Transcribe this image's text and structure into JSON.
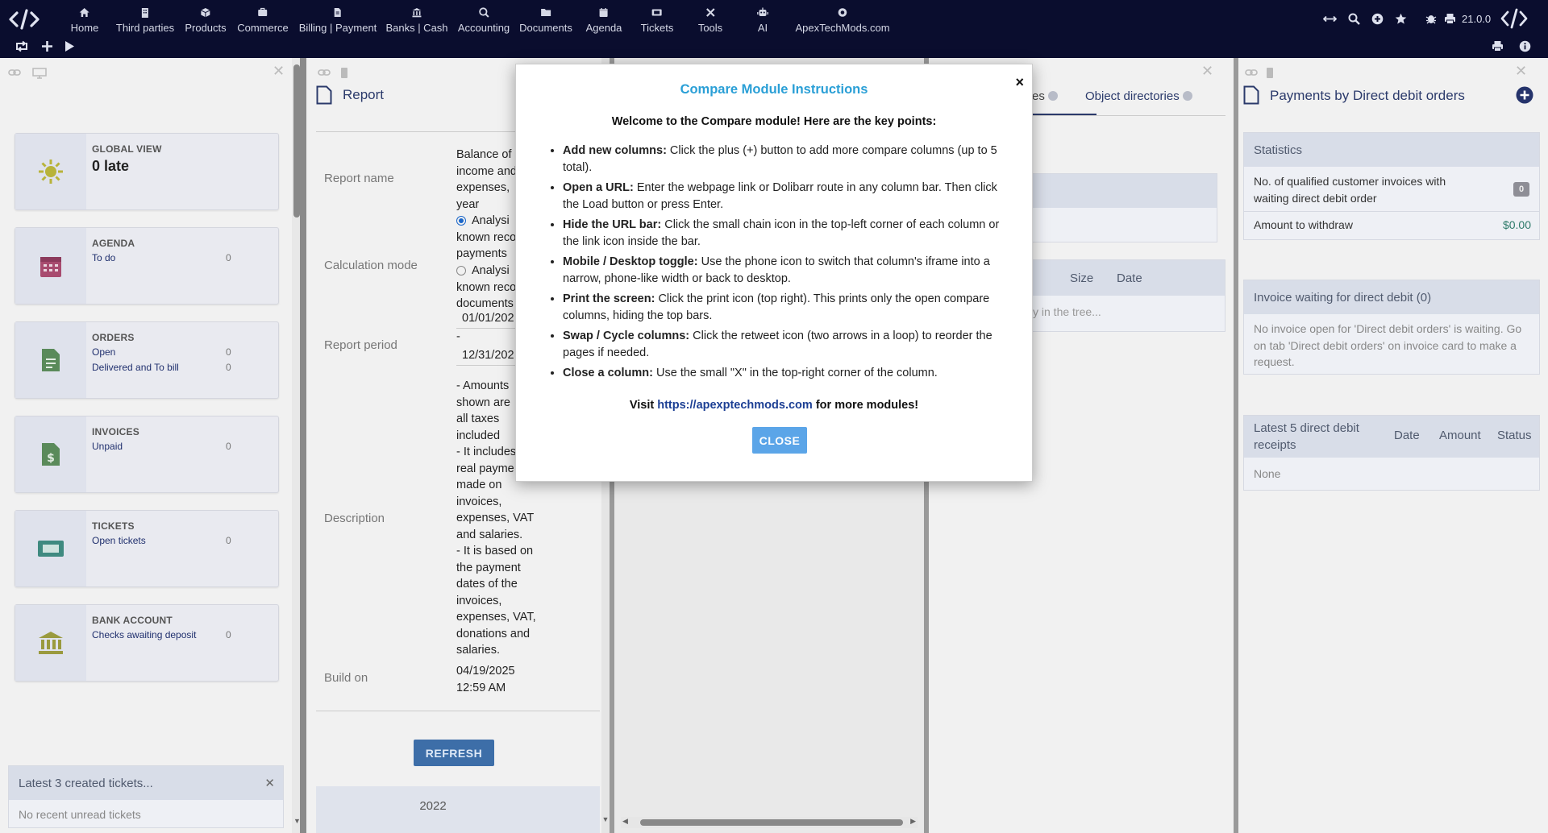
{
  "topbar": {
    "menu": [
      {
        "label": "Home",
        "icon": "home-icon"
      },
      {
        "label": "Third parties",
        "icon": "building-icon"
      },
      {
        "label": "Products",
        "icon": "cube-icon"
      },
      {
        "label": "Commerce",
        "icon": "briefcase-icon"
      },
      {
        "label": "Billing | Payment",
        "icon": "file-invoice-icon"
      },
      {
        "label": "Banks | Cash",
        "icon": "bank-icon"
      },
      {
        "label": "Accounting",
        "icon": "search-dollar-icon"
      },
      {
        "label": "Documents",
        "icon": "folder-icon"
      },
      {
        "label": "Agenda",
        "icon": "calendar-icon"
      },
      {
        "label": "Tickets",
        "icon": "ticket-icon"
      },
      {
        "label": "Tools",
        "icon": "tools-icon"
      },
      {
        "label": "AI",
        "icon": "robot-icon"
      },
      {
        "label": "ApexTechMods.com",
        "icon": "globe-icon"
      }
    ],
    "version": "21.0.0"
  },
  "left_panel": {
    "widgets": [
      {
        "title": "GLOBAL VIEW",
        "big": "0 late",
        "icon": "sun-icon"
      },
      {
        "title": "AGENDA",
        "lines": [
          {
            "label": "To do",
            "count": "0"
          }
        ],
        "icon": "calendar-icon"
      },
      {
        "title": "ORDERS",
        "lines": [
          {
            "label": "Open",
            "count": "0"
          },
          {
            "label": "Delivered and To bill",
            "count": "0"
          }
        ],
        "icon": "order-file-icon"
      },
      {
        "title": "INVOICES",
        "lines": [
          {
            "label": "Unpaid",
            "count": "0"
          }
        ],
        "icon": "invoice-dollar-icon"
      },
      {
        "title": "TICKETS",
        "lines": [
          {
            "label": "Open tickets",
            "count": "0"
          }
        ],
        "icon": "ticket-icon"
      },
      {
        "title": "BANK ACCOUNT",
        "lines": [
          {
            "label": "Checks awaiting deposit",
            "count": "0"
          }
        ],
        "icon": "bank-icon"
      }
    ],
    "tickets_box": {
      "title": "Latest 3 created tickets...",
      "empty": "No recent unread tickets"
    }
  },
  "report_panel": {
    "title": "Report",
    "labels": {
      "report_name": "Report name",
      "calculation_mode": "Calculation mode",
      "report_period": "Report period",
      "description": "Description",
      "build_on": "Build on"
    },
    "report_name_lines": [
      "Balance of",
      "income and",
      "expenses,",
      "year"
    ],
    "calc_option_1": [
      "Analysi",
      "known reco",
      "payments"
    ],
    "calc_option_2": [
      "Analysi",
      "known reco",
      "documents"
    ],
    "period_from": "01/01/202",
    "period_dash": "-",
    "period_to": "12/31/202",
    "description_lines": [
      "- Amounts",
      "shown are",
      "all taxes",
      "included",
      "- It includes",
      "real payme",
      "made on",
      "invoices,",
      "expenses, VAT",
      "and salaries.",
      "- It is based on",
      "the payment",
      "dates of the",
      "invoices,",
      "expenses, VAT,",
      "donations and",
      "salaries."
    ],
    "build_on_lines": [
      "04/19/2025",
      "12:59 AM"
    ],
    "refresh_label": "REFRESH",
    "year_header": "2022"
  },
  "docs_panel": {
    "tabs": [
      {
        "label": "es"
      },
      {
        "label": "Object directories"
      }
    ],
    "columns": {
      "size": "Size",
      "date": "Date"
    },
    "tree_hint": "y in the tree..."
  },
  "right_panel": {
    "title": "Payments by Direct debit orders",
    "statistics": {
      "title": "Statistics",
      "row1_label": "No. of qualified customer invoices with waiting direct debit order",
      "row1_value": "0",
      "row2_label": "Amount to withdraw",
      "row2_value": "$0.00"
    },
    "waiting": {
      "title": "Invoice waiting for direct debit (0)",
      "text": "No invoice open for 'Direct debit orders' is waiting. Go on tab 'Direct debit orders' on invoice card to make a request."
    },
    "latest": {
      "title": "Latest 5 direct debit receipts",
      "col_date": "Date",
      "col_amount": "Amount",
      "col_status": "Status",
      "empty": "None"
    }
  },
  "modal": {
    "title": "Compare Module Instructions",
    "intro": "Welcome to the Compare module! Here are the key points:",
    "items": [
      {
        "bold": "Add new columns:",
        "text": " Click the plus (+) button to add more compare columns (up to 5 total)."
      },
      {
        "bold": "Open a URL:",
        "text": " Enter the webpage link or Dolibarr route in any column bar. Then click the Load button or press Enter."
      },
      {
        "bold": "Hide the URL bar:",
        "text": " Click the small chain icon in the top-left corner of each column or the link icon inside the bar."
      },
      {
        "bold": "Mobile / Desktop toggle:",
        "text": " Use the phone icon to switch that column's iframe into a narrow, phone-like width or back to desktop."
      },
      {
        "bold": "Print the screen:",
        "text": " Click the print icon (top right). This prints only the open compare columns, hiding the top bars."
      },
      {
        "bold": "Swap / Cycle columns:",
        "text": " Click the retweet icon (two arrows in a loop) to reorder the pages if needed."
      },
      {
        "bold": "Close a column:",
        "text": " Use the small \"X\" in the top-right corner of the column."
      }
    ],
    "visit_prefix": "Visit ",
    "visit_link": "https://apexptechmods.com",
    "visit_suffix": " for more modules!",
    "close_label": "CLOSE",
    "close_x": "×"
  },
  "colors": {
    "topbar": "#0a0d2e",
    "link": "#1c3f94",
    "modal_title": "#2a9fd6",
    "close_btn": "#5ba5e8",
    "refresh_btn": "#3d6ea8",
    "money": "#2d7a6a"
  }
}
